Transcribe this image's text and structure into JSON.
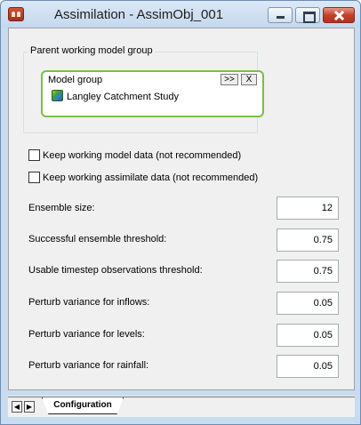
{
  "window": {
    "title": "Assimilation - AssimObj_001"
  },
  "parent_group": {
    "label": "Parent working model group",
    "panel_label": "Model group",
    "go_button": ">>",
    "clear_button": "X",
    "item": "Langley Catchment Study"
  },
  "options": {
    "keep_model": "Keep working model data (not recommended)",
    "keep_assimilate": "Keep working assimilate data (not recommended)"
  },
  "fields": {
    "ensemble_size": {
      "label": "Ensemble size:",
      "value": "12"
    },
    "success_threshold": {
      "label": "Successful ensemble threshold:",
      "value": "0.75"
    },
    "usable_threshold": {
      "label": "Usable timestep observations threshold:",
      "value": "0.75"
    },
    "perturb_inflows": {
      "label": "Perturb variance for inflows:",
      "value": "0.05"
    },
    "perturb_levels": {
      "label": "Perturb variance for levels:",
      "value": "0.05"
    },
    "perturb_rainfall": {
      "label": "Perturb variance for rainfall:",
      "value": "0.05"
    }
  },
  "tabs": {
    "prev": "◀",
    "next": "▶",
    "active": "Configuration"
  },
  "icons": {
    "app": "app-icon",
    "model_group": "model-group-icon"
  }
}
